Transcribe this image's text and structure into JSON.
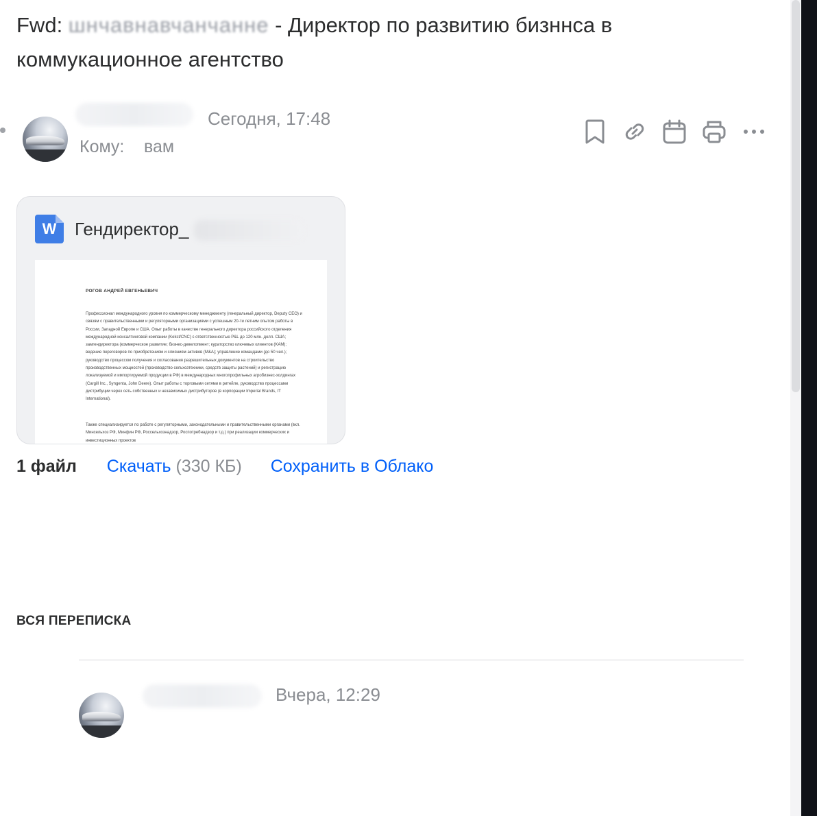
{
  "subject": {
    "prefix": "Fwd: ",
    "blurred": "шнчавнавчанчанне",
    "rest": " - Директор по развитию бизннса в коммукационное агентство"
  },
  "message": {
    "date": "Сегодня, 17:48",
    "to_label": "Кому:",
    "to_value": "вам"
  },
  "toolbar": {
    "bookmark_icon": "bookmark-icon",
    "link_icon": "link-icon",
    "calendar_icon": "calendar-icon",
    "print_icon": "print-icon",
    "more_icon": "more-icon"
  },
  "attachment": {
    "icon_letter": "W",
    "file_name": "Гендиректор_",
    "preview_title": "РОГОВ АНДРЕЙ ЕВГЕНЬЕВИЧ",
    "preview_paragraph1": "Профессионал международного уровня по коммерческому менеджменту (генеральный директор, Deputy CEO) и связям с правительственными и регуляторными организациями с успешным 20-ти летним опытом работы в России, Западной Европе и США. Опыт работы в качестве генерального директора российского отделения международной консалтинговой компании (Kekst/CNC) с ответственностью P&L до 120 млн. долл. США; замгендиректора (коммерческое развитие; бизнес-девелопмент; кураторство ключевых клиентов (KAM); ведение переговоров по приобретениям и слияниям активов (M&A); управление командами (до 50 чел.); руководство процессом получения и согласования разрешительных документов на строительство производственных мощностей (производство сельхозтехники, средств защиты растений) и регистрацию локализуемой и импортируемой продукции в РФ) в международных многопрофильных агробизнес-холдингах (Cargill Inc., Syngenta, John Deere). Опыт работы с торговыми сетями в ритейле, руководство процессами дистрибуции через сеть собственных и независимых дистрибуторов (в корпорации Imperial Brands, IT International).",
    "preview_paragraph2": "Также специализируется по работе с регуляторными, законодательными и правительственными органами (вкл. Минсельхоз РФ, Минфин РФ, Россельхознадзор, Роспотребнадзор и т.д.) при реализации коммерческих и инвестиционных проектов"
  },
  "files": {
    "count": "1 файл",
    "download": "Скачать",
    "size": " (330 КБ)",
    "save_cloud": "Сохранить в Облако"
  },
  "thread": {
    "heading": "ВСЯ ПЕРЕПИСКА",
    "items": [
      {
        "date": "Вчера, 12:29"
      }
    ]
  }
}
